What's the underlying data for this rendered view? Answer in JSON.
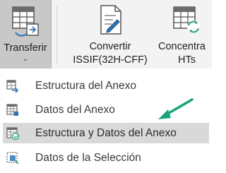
{
  "ribbon": {
    "transferir": {
      "label": "Transferir",
      "dropdown_glyph": "⌄",
      "icon": "table-grid-icon"
    },
    "convertir": {
      "line1": "Convertir",
      "line2": "ISSIF(32H-CFF)",
      "icon": "document-edit-icon"
    },
    "concentra": {
      "line1": "Concentra",
      "line2": "HTs",
      "icon": "table-refresh-icon"
    }
  },
  "menu": {
    "items": [
      {
        "label": "Estructura del Anexo",
        "icon": "structure-transfer-icon",
        "highlighted": false
      },
      {
        "label": "Datos del Anexo",
        "icon": "data-table-icon",
        "highlighted": false
      },
      {
        "label": "Estructura y Datos del Anexo",
        "icon": "structure-data-icon",
        "highlighted": true
      },
      {
        "label": "Datos de la Selección",
        "icon": "selection-icon",
        "highlighted": false
      }
    ]
  },
  "colors": {
    "ribbon_bg": "#f3f3f3",
    "pressed_button": "#c8c8c8",
    "highlight_row": "#d9d9d9",
    "icon_blue": "#2e75b6",
    "icon_green": "#3aa76d",
    "annotation_arrow": "#1aa37a"
  }
}
